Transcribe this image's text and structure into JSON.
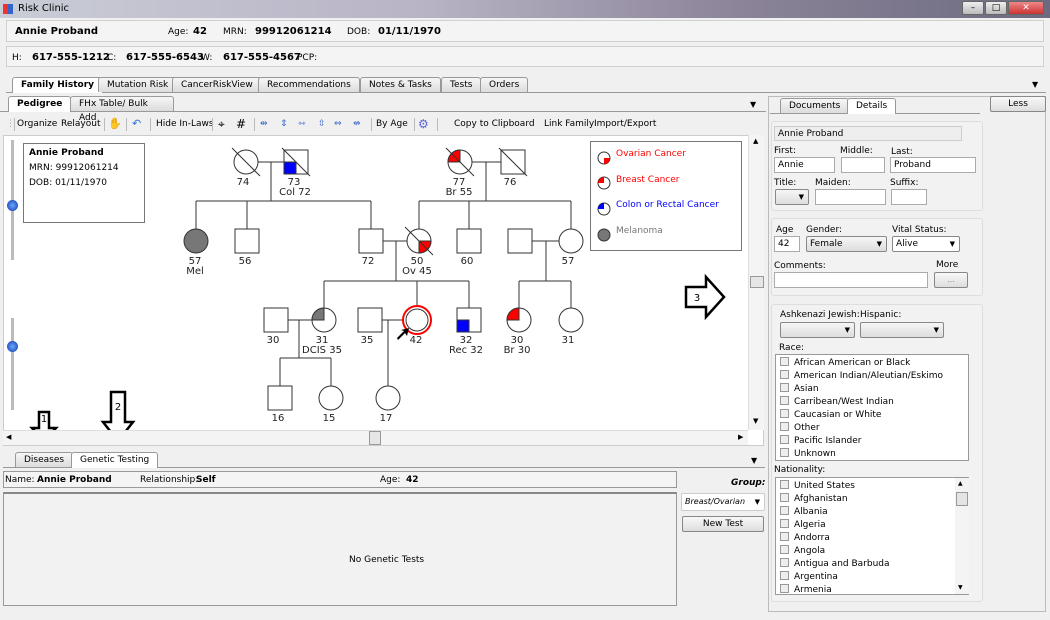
{
  "window": {
    "title": "Risk Clinic"
  },
  "patient": {
    "name": "Annie Proband",
    "age_label": "Age:",
    "age": "42",
    "mrn_label": "MRN:",
    "mrn": "99912061214",
    "dob_label": "DOB:",
    "dob": "01/11/1970",
    "h_label": "H:",
    "home": "617-555-1212",
    "c_label": "C:",
    "cell": "617-555-6543",
    "w_label": "W:",
    "work": "617-555-4567",
    "pcp_label": "PCP:"
  },
  "main_tabs": [
    "Family History",
    "Mutation Risk",
    "CancerRiskView",
    "Recommendations",
    "Notes & Tasks",
    "Tests",
    "Orders"
  ],
  "sub_tabs": [
    "Pedigree",
    "FHx Table/ Bulk Add"
  ],
  "toolbar": {
    "organize": "Organize",
    "relayout": "Relayout",
    "hide_inlaws": "Hide In-Laws",
    "by_age": "By Age",
    "copy": "Copy to Clipboard",
    "link": "Link Family",
    "import_export": "Import/Export"
  },
  "proband_card": {
    "name": "Annie Proband",
    "mrn": "MRN: 99912061214",
    "dob": "DOB: 01/11/1970"
  },
  "legend": [
    {
      "label": "Ovarian Cancer",
      "color": "#ff0000"
    },
    {
      "label": "Breast Cancer",
      "color": "#ff0000"
    },
    {
      "label": "Colon or Rectal Cancer",
      "color": "#0000ff"
    },
    {
      "label": "Melanoma",
      "color": "#808080"
    }
  ],
  "pedigree": {
    "p74": "74",
    "p73": "73",
    "p73d": "Col 72",
    "p77": "77",
    "p77d": "Br 55",
    "p76": "76",
    "p57m": "57",
    "p57md": "Mel",
    "p56": "56",
    "p72": "72",
    "p50": "50",
    "p50d": "Ov 45",
    "p60": "60",
    "p57": "57",
    "p30": "30",
    "p31": "31",
    "p31d": "DCIS 35",
    "p35": "35",
    "p42": "42",
    "p32": "32",
    "p32d": "Rec 32",
    "p30b": "30",
    "p30bd": "Br 30",
    "p31b": "31",
    "p16": "16",
    "p15": "15",
    "p17": "17"
  },
  "annotations": {
    "a1": "1",
    "a2": "2",
    "a3": "3"
  },
  "bottom_tabs": [
    "Diseases",
    "Genetic Testing"
  ],
  "genetic": {
    "name_label": "Name:",
    "name": "Annie Proband",
    "rel_label": "Relationship:",
    "rel": "Self",
    "age_label": "Age:",
    "age": "42",
    "empty": "No Genetic Tests",
    "group_label": "Group:",
    "group": "Breast/Ovarian",
    "new_test": "New Test"
  },
  "right_tabs": [
    "Documents",
    "Details"
  ],
  "less": "Less",
  "details": {
    "full_name": "Annie Proband",
    "first_label": "First:",
    "first": "Annie",
    "middle_label": "Middle:",
    "middle": "",
    "last_label": "Last:",
    "last": "Proband",
    "title_label": "Title:",
    "maiden_label": "Maiden:",
    "suffix_label": "Suffix:",
    "age_label": "Age",
    "age": "42",
    "gender_label": "Gender:",
    "gender": "Female",
    "vital_label": "Vital Status:",
    "vital": "Alive",
    "comments_label": "Comments:",
    "more_label": "More",
    "more_btn": "...",
    "ashkenazi_label": "Ashkenazi Jewish:",
    "hispanic_label": "Hispanic:",
    "race_label": "Race:",
    "races": [
      "African American or Black",
      "American Indian/Aleutian/Eskimo",
      "Asian",
      "Carribean/West Indian",
      "Caucasian or White",
      "Other",
      "Pacific Islander",
      "Unknown"
    ],
    "nationality_label": "Nationality:",
    "nationalities": [
      "United States",
      "Afghanistan",
      "Albania",
      "Algeria",
      "Andorra",
      "Angola",
      "Antigua and Barbuda",
      "Argentina",
      "Armenia"
    ]
  }
}
